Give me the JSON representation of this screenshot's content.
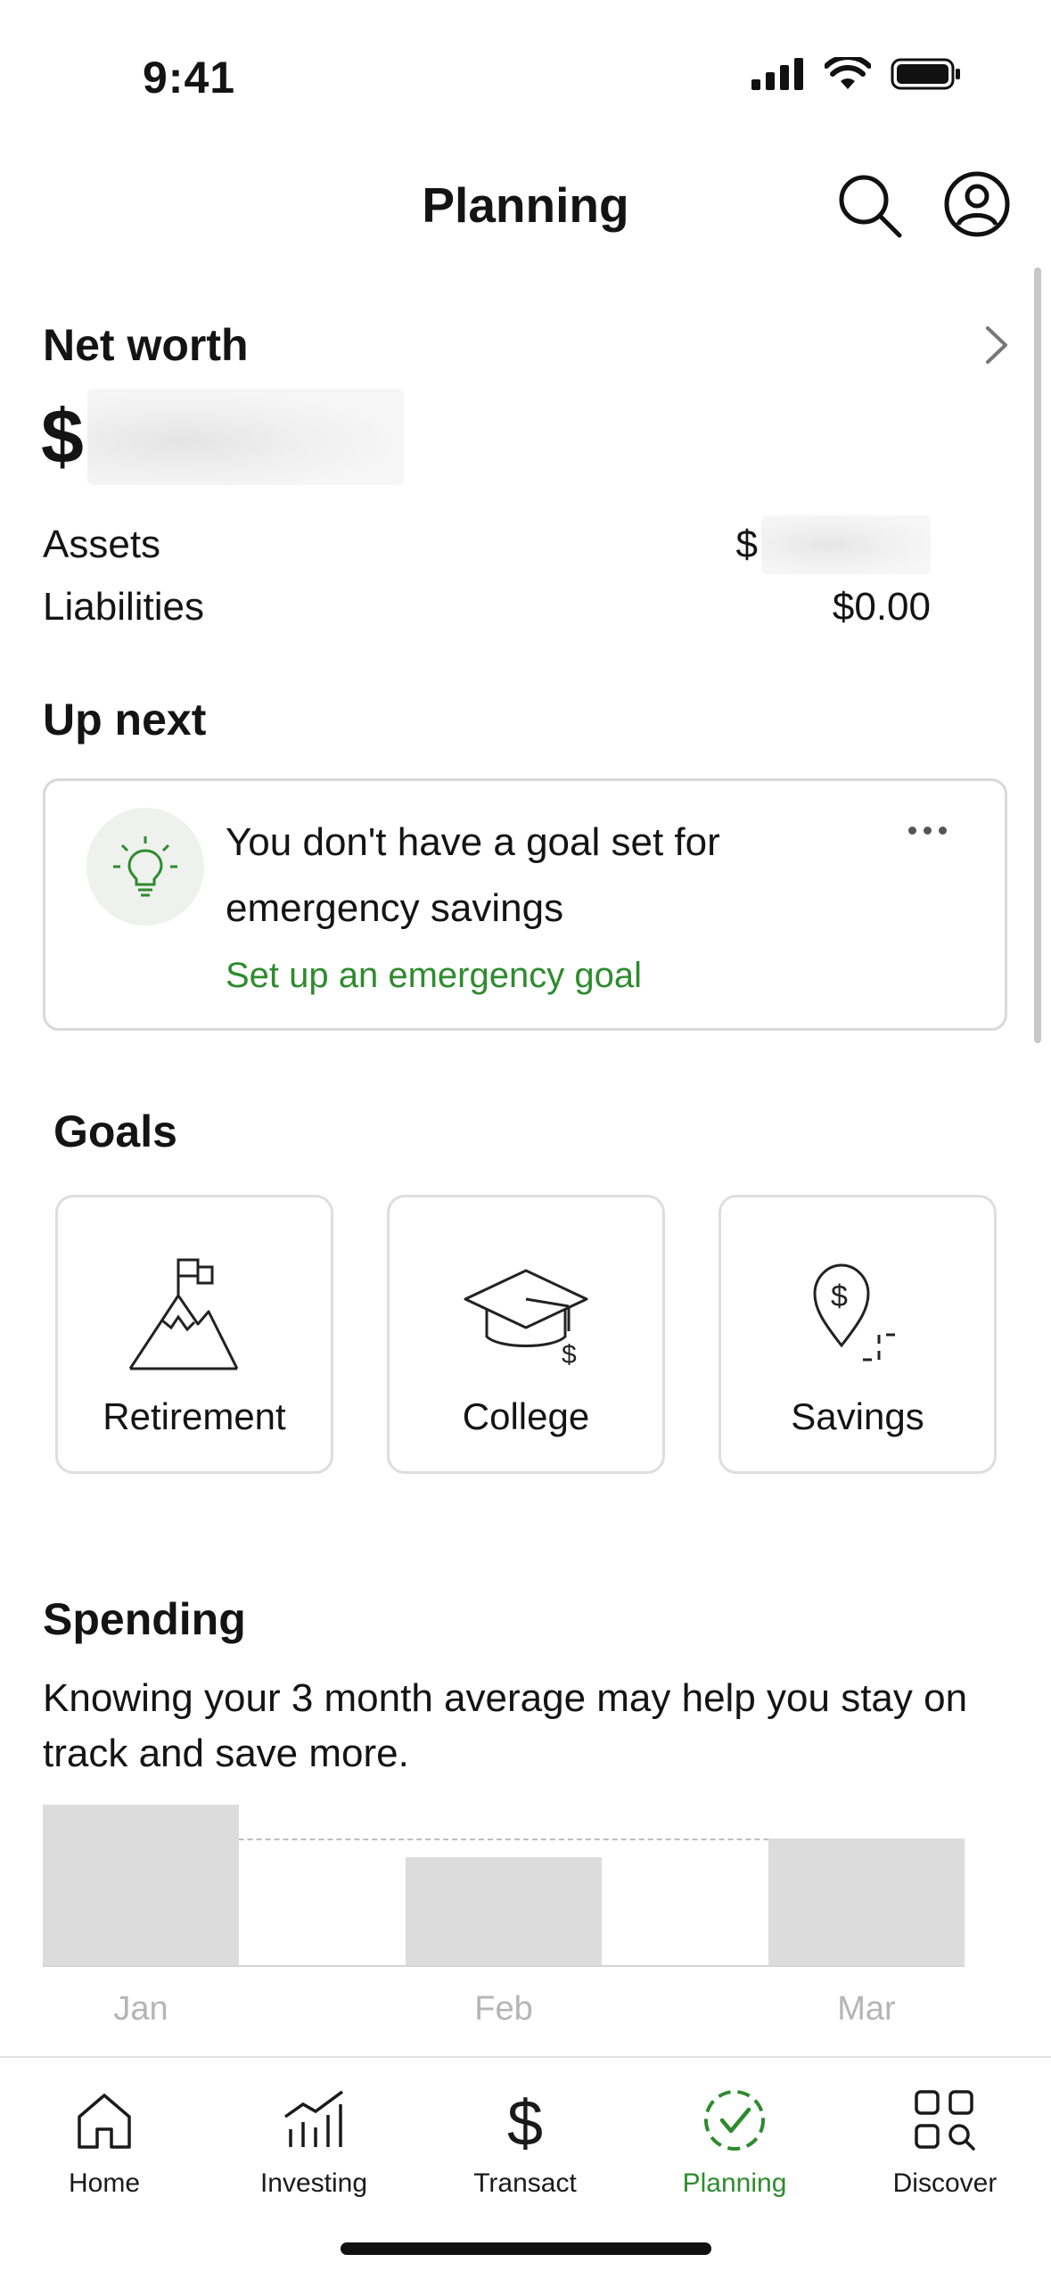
{
  "status_bar": {
    "time": "9:41"
  },
  "header": {
    "title": "Planning"
  },
  "net_worth": {
    "label": "Net worth",
    "currency_symbol": "$",
    "assets_label": "Assets",
    "assets_currency_symbol": "$",
    "liabilities_label": "Liabilities",
    "liabilities_value": "$0.00"
  },
  "up_next": {
    "title": "Up next",
    "card": {
      "message": "You don't have a goal set for emergency savings",
      "link": "Set up an emergency goal"
    }
  },
  "goals": {
    "title": "Goals",
    "items": [
      {
        "label": "Retirement",
        "icon": "mountain-flag-icon"
      },
      {
        "label": "College",
        "icon": "graduation-cap-icon"
      },
      {
        "label": "Savings",
        "icon": "location-dollar-icon"
      }
    ]
  },
  "spending": {
    "title": "Spending",
    "description": "Knowing your 3 month average may help you stay on track and save more."
  },
  "chart_data": {
    "type": "bar",
    "categories": [
      "Jan",
      "Feb",
      "Mar"
    ],
    "values": [
      1.0,
      0.67,
      0.79
    ],
    "average_line": 0.79,
    "title": "",
    "xlabel": "",
    "ylabel": "",
    "ylim": [
      0,
      1
    ],
    "grid": false
  },
  "tabs": [
    {
      "label": "Home",
      "icon": "home-icon",
      "active": false
    },
    {
      "label": "Investing",
      "icon": "investing-chart-icon",
      "active": false
    },
    {
      "label": "Transact",
      "icon": "dollar-icon",
      "active": false
    },
    {
      "label": "Planning",
      "icon": "planning-check-icon",
      "active": true
    },
    {
      "label": "Discover",
      "icon": "discover-grid-icon",
      "active": false
    }
  ],
  "colors": {
    "accent_green": "#2e8b2e",
    "bar_gray": "#dcdcdc",
    "text": "#141414"
  }
}
